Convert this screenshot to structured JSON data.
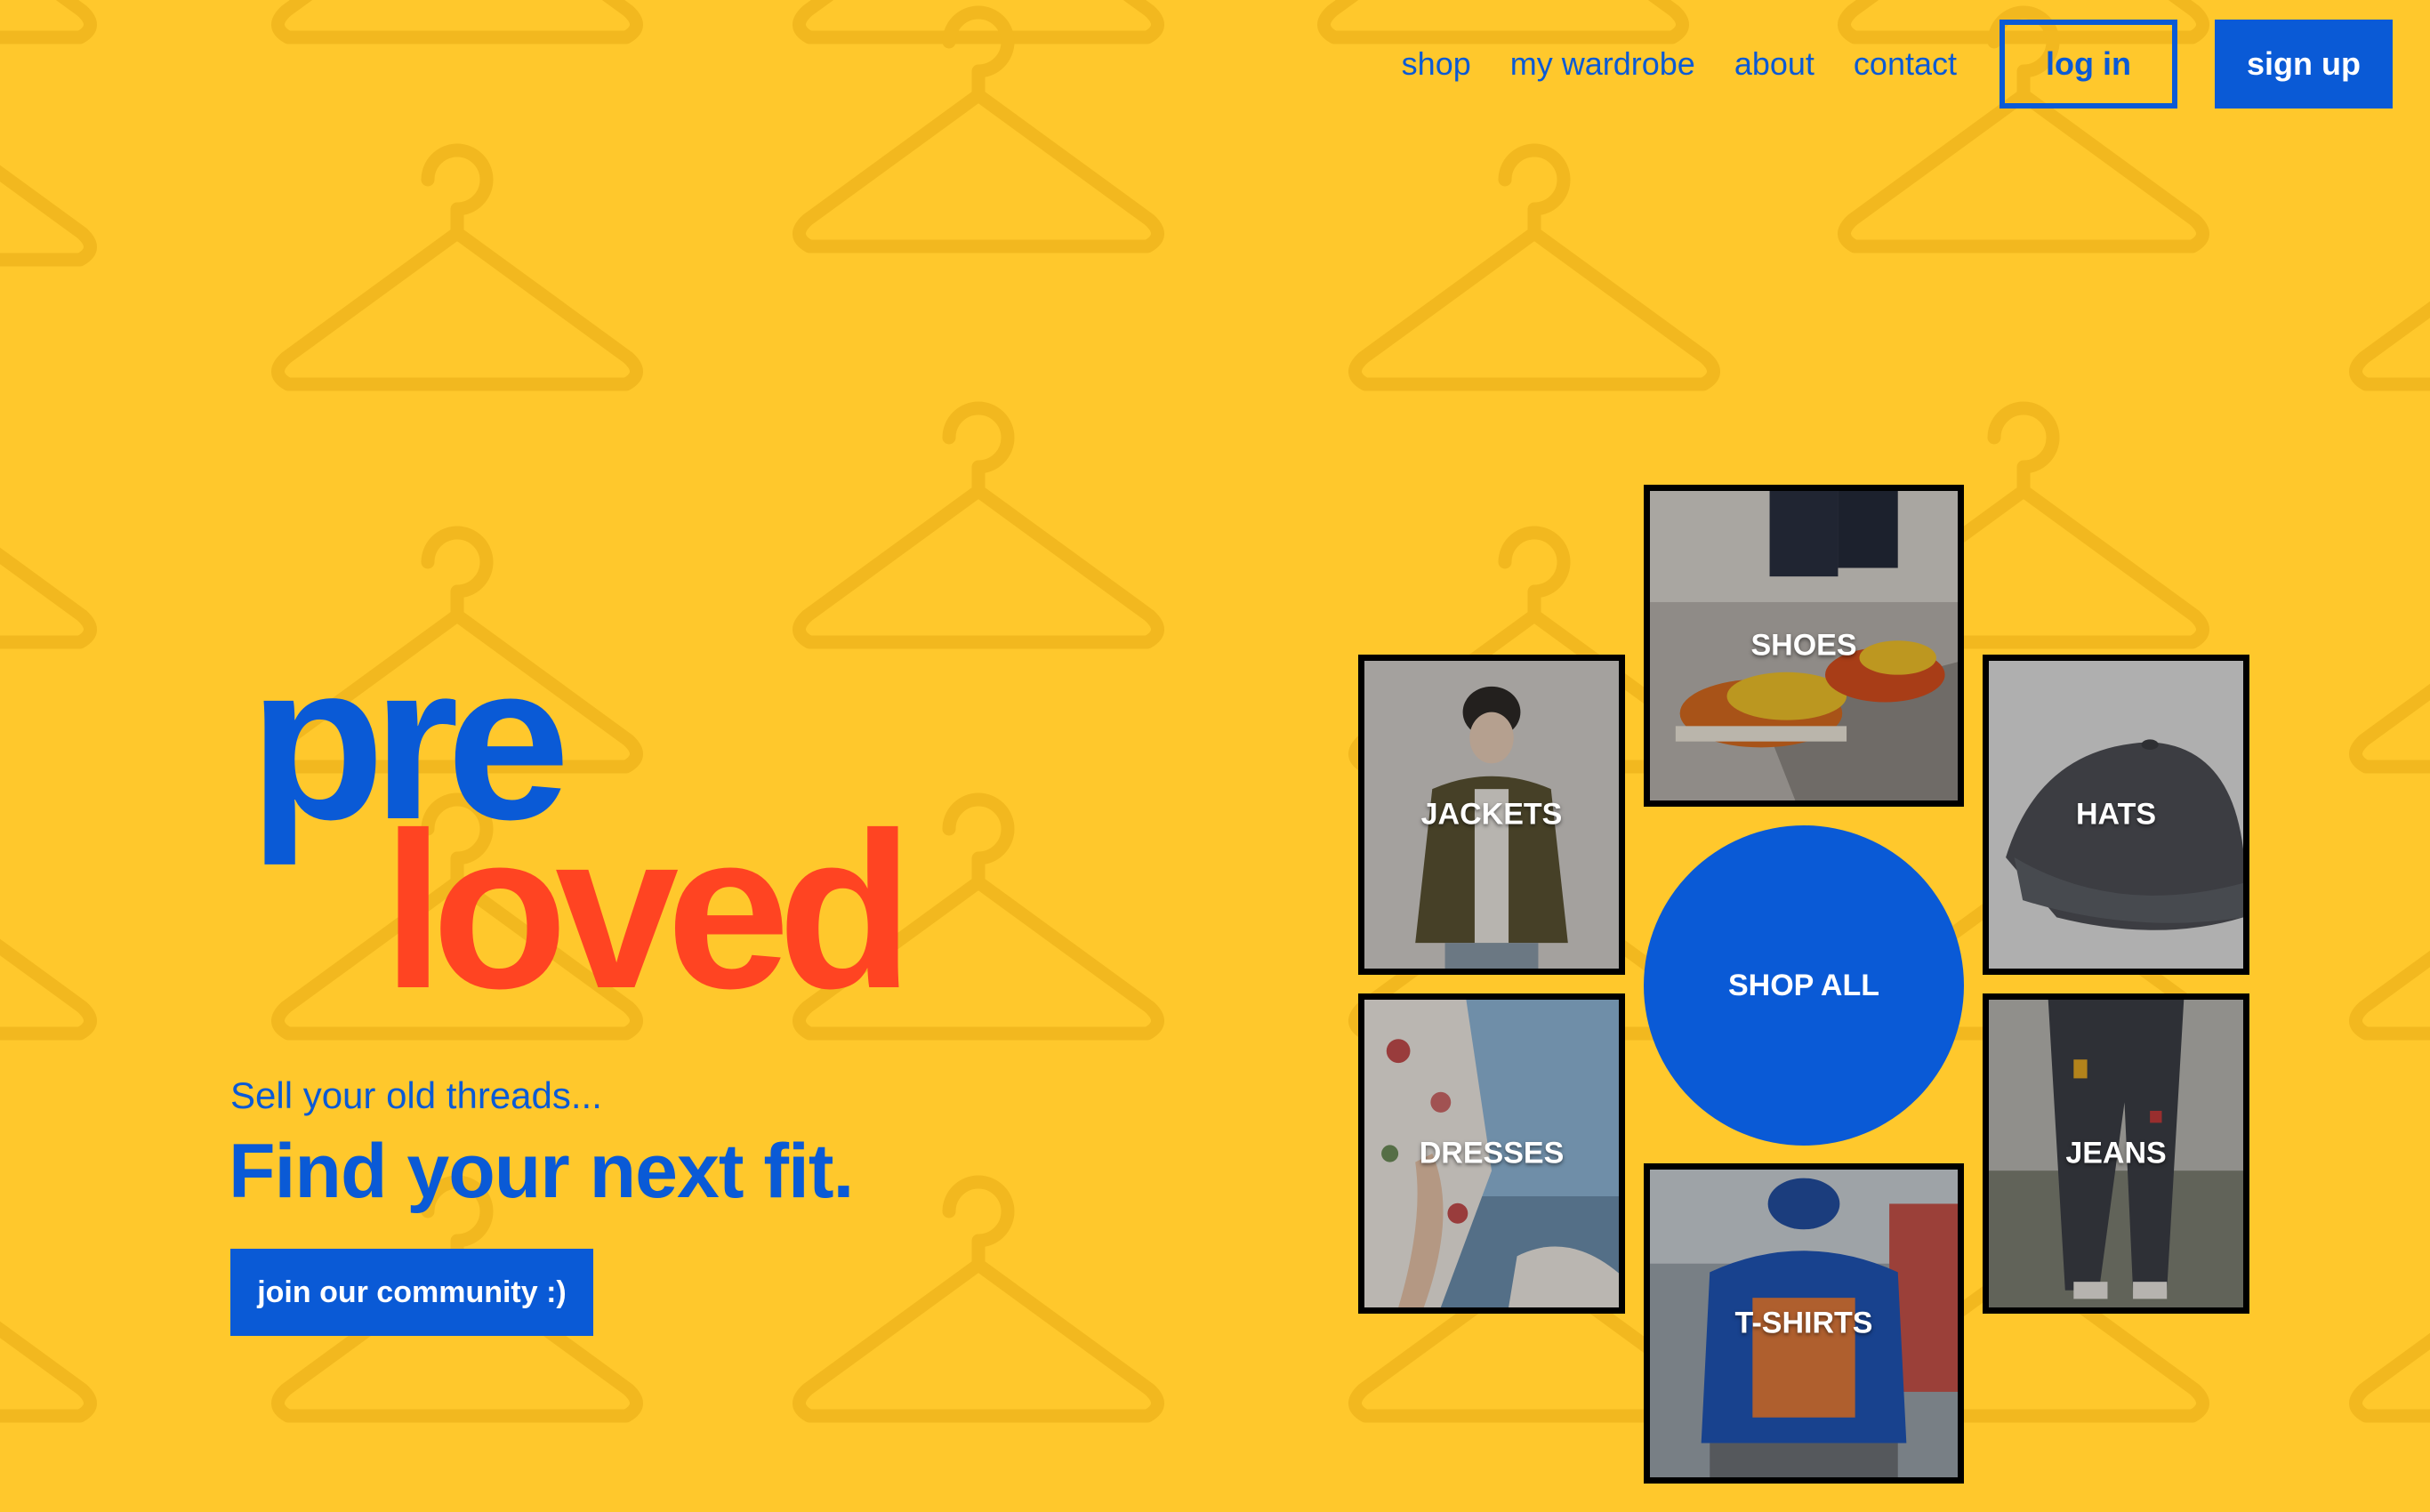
{
  "nav": {
    "links": [
      {
        "label": "shop"
      },
      {
        "label": "my wardrobe"
      },
      {
        "label": "about"
      },
      {
        "label": "contact"
      }
    ],
    "login_label": "log in",
    "signup_label": "sign up"
  },
  "logo": {
    "part1": "pre",
    "part2": "loved",
    "part1_color": "#0a5ad6",
    "part2_color": "#ff4422"
  },
  "hero": {
    "tagline": "Sell your old threads...",
    "headline": "Find your next fit.",
    "cta_label": "join our community :)"
  },
  "categories": {
    "shoes": "SHOES",
    "jackets": "JACKETS",
    "hats": "HATS",
    "dresses": "DRESSES",
    "jeans": "JEANS",
    "tshirts": "T-SHIRTS",
    "shop_all": "SHOP ALL"
  },
  "colors": {
    "background": "#ffc82c",
    "primary": "#0a5ad6",
    "accent": "#ff4422",
    "pattern": "#f0b91e"
  },
  "background_pattern_icon": "hanger-icon"
}
